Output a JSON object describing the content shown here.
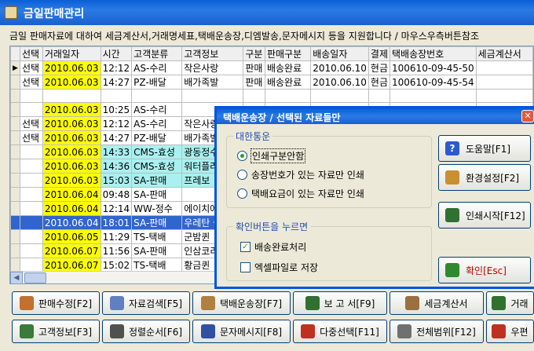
{
  "window": {
    "title": "금일판매관리"
  },
  "info_text": "금일 판매자료에 대하여 세금계산서,거래명세표,택배운송장,디엠발송,문자메시지 등을 지원합니다 / 마우스우측버튼참조",
  "grid": {
    "columns": [
      "",
      "선택",
      "거래일자",
      "시간",
      "고객분류",
      "고객정보",
      "구분",
      "판매구분",
      "배송일자",
      "결제",
      "택배송장번호",
      "세금계산서"
    ],
    "rows": [
      {
        "marker": "▶",
        "sel": "선택",
        "date": "2010.06.03",
        "time": "12:12",
        "cust": "AS-수리",
        "cname": "작은사랑",
        "type": "판매",
        "sale": "배송완료",
        "ship": "2010.06.10",
        "pay": "현금",
        "track": "100610-09-45-50",
        "tax": ""
      },
      {
        "marker": "",
        "sel": "선택",
        "date": "2010.06.03",
        "time": "14:27",
        "cust": "PZ-배달",
        "cname": "배가족발",
        "type": "판매",
        "sale": "배송완료",
        "ship": "2010.06.10",
        "pay": "현금",
        "track": "100610-09-45-54",
        "tax": ""
      },
      {
        "marker": "",
        "sel": "",
        "date": "",
        "time": "",
        "cust": "",
        "cname": "",
        "type": "",
        "sale": "",
        "ship": "",
        "pay": "",
        "track": "",
        "tax": ""
      },
      {
        "marker": "",
        "sel": "",
        "date": "2010.06.03",
        "time": "10:25",
        "cust": "AS-수리",
        "cname": "",
        "type": "",
        "sale": "",
        "ship": "",
        "pay": "",
        "track": "",
        "tax": ""
      },
      {
        "marker": "",
        "sel": "선택",
        "date": "2010.06.03",
        "time": "12:12",
        "cust": "AS-수리",
        "cname": "작은사랑",
        "type": "",
        "sale": "",
        "ship": "",
        "pay": "",
        "track": "",
        "tax": ""
      },
      {
        "marker": "",
        "sel": "선택",
        "date": "2010.06.03",
        "time": "14:27",
        "cust": "PZ-배달",
        "cname": "배가족발",
        "type": "",
        "sale": "",
        "ship": "",
        "pay": "",
        "track": "",
        "tax": ""
      },
      {
        "marker": "",
        "sel": "",
        "date": "2010.06.03",
        "time": "14:33",
        "cust": "CMS-효성",
        "cname": "광동정수",
        "type": "",
        "sale": "",
        "ship": "",
        "pay": "",
        "track": "",
        "tax": "",
        "cyan": true
      },
      {
        "marker": "",
        "sel": "",
        "date": "2010.06.03",
        "time": "14:36",
        "cust": "CMS-효성",
        "cname": "워터플러",
        "type": "",
        "sale": "",
        "ship": "",
        "pay": "",
        "track": "",
        "tax": "",
        "cyan": true
      },
      {
        "marker": "",
        "sel": "",
        "date": "2010.06.03",
        "time": "15:03",
        "cust": "SA-판매",
        "cname": "프레보",
        "type": "",
        "sale": "",
        "ship": "",
        "pay": "",
        "track": "",
        "tax": "",
        "cyan": true
      },
      {
        "marker": "",
        "sel": "",
        "date": "2010.06.04",
        "time": "09:48",
        "cust": "SA-판매",
        "cname": "",
        "type": "",
        "sale": "",
        "ship": "",
        "pay": "",
        "track": "",
        "tax": ""
      },
      {
        "marker": "",
        "sel": "",
        "date": "2010.06.04",
        "time": "12:14",
        "cust": "WW-정수",
        "cname": "에이치에",
        "type": "",
        "sale": "",
        "ship": "",
        "pay": "",
        "track": "",
        "tax": ""
      },
      {
        "marker": "",
        "sel": "",
        "date": "2010.06.04",
        "time": "18:01",
        "cust": "SA-판매",
        "cname": "우레탄 솔",
        "type": "",
        "sale": "",
        "ship": "",
        "pay": "",
        "track": "",
        "tax": "",
        "selected": true
      },
      {
        "marker": "",
        "sel": "",
        "date": "2010.06.05",
        "time": "11:29",
        "cust": "TS-택배",
        "cname": "군밤퀸",
        "type": "",
        "sale": "",
        "ship": "",
        "pay": "",
        "track": "",
        "tax": ""
      },
      {
        "marker": "",
        "sel": "",
        "date": "2010.06.07",
        "time": "11:56",
        "cust": "SA-판매",
        "cname": "인삼코리",
        "type": "",
        "sale": "",
        "ship": "",
        "pay": "",
        "track": "",
        "tax": ""
      },
      {
        "marker": "",
        "sel": "",
        "date": "2010.06.07",
        "time": "15:02",
        "cust": "TS-택배",
        "cname": "황금퀸",
        "type": "",
        "sale": "",
        "ship": "",
        "pay": "",
        "track": "",
        "tax": ""
      }
    ]
  },
  "buttons_row1": [
    {
      "label": "판매수정[F2]",
      "icon": "edit-icon",
      "color": "#c07030"
    },
    {
      "label": "자료검색[F5]",
      "icon": "search-icon",
      "color": "#6080c0"
    },
    {
      "label": "택배운송장[F7]",
      "icon": "parcel-icon",
      "color": "#b08040"
    },
    {
      "label": "보 고 서[F9]",
      "icon": "printer-icon",
      "color": "#307030"
    },
    {
      "label": "세금계산서",
      "icon": "invoice-icon",
      "color": "#9a7040"
    },
    {
      "label": "거래",
      "icon": "printer2-icon",
      "color": "#307030"
    }
  ],
  "buttons_row2": [
    {
      "label": "고객정보[F3]",
      "icon": "customer-icon",
      "color": "#3a7a3a"
    },
    {
      "label": "정렬순서[F6]",
      "icon": "sort-icon",
      "color": "#505050"
    },
    {
      "label": "문자메시지[F8]",
      "icon": "message-icon",
      "color": "#3050a0"
    },
    {
      "label": "다중선택[F11]",
      "icon": "multiselect-icon",
      "color": "#c03020"
    },
    {
      "label": "전체범위[F12]",
      "icon": "range-icon",
      "color": "#707070"
    },
    {
      "label": "우편",
      "icon": "mail-icon",
      "color": "#c03020"
    }
  ],
  "dialog": {
    "title": "택배운송장 / 선택된 자료들만",
    "group1_label": "대한통운",
    "options": [
      "인쇄구분안함",
      "송장번호가 있는 자료만 인쇄",
      "택배요금이 있는 자료만 인쇄"
    ],
    "selected_option": 0,
    "group2_label": "확인버튼을 누르면",
    "check1": "배송완료처리",
    "check1_on": true,
    "check2": "엑셀파일로 저장",
    "check2_on": false,
    "btn_help": "도움말[F1]",
    "btn_settings": "환경설정[F2]",
    "btn_print": "인쇄시작[F12]",
    "btn_ok": "확인[Esc]"
  }
}
